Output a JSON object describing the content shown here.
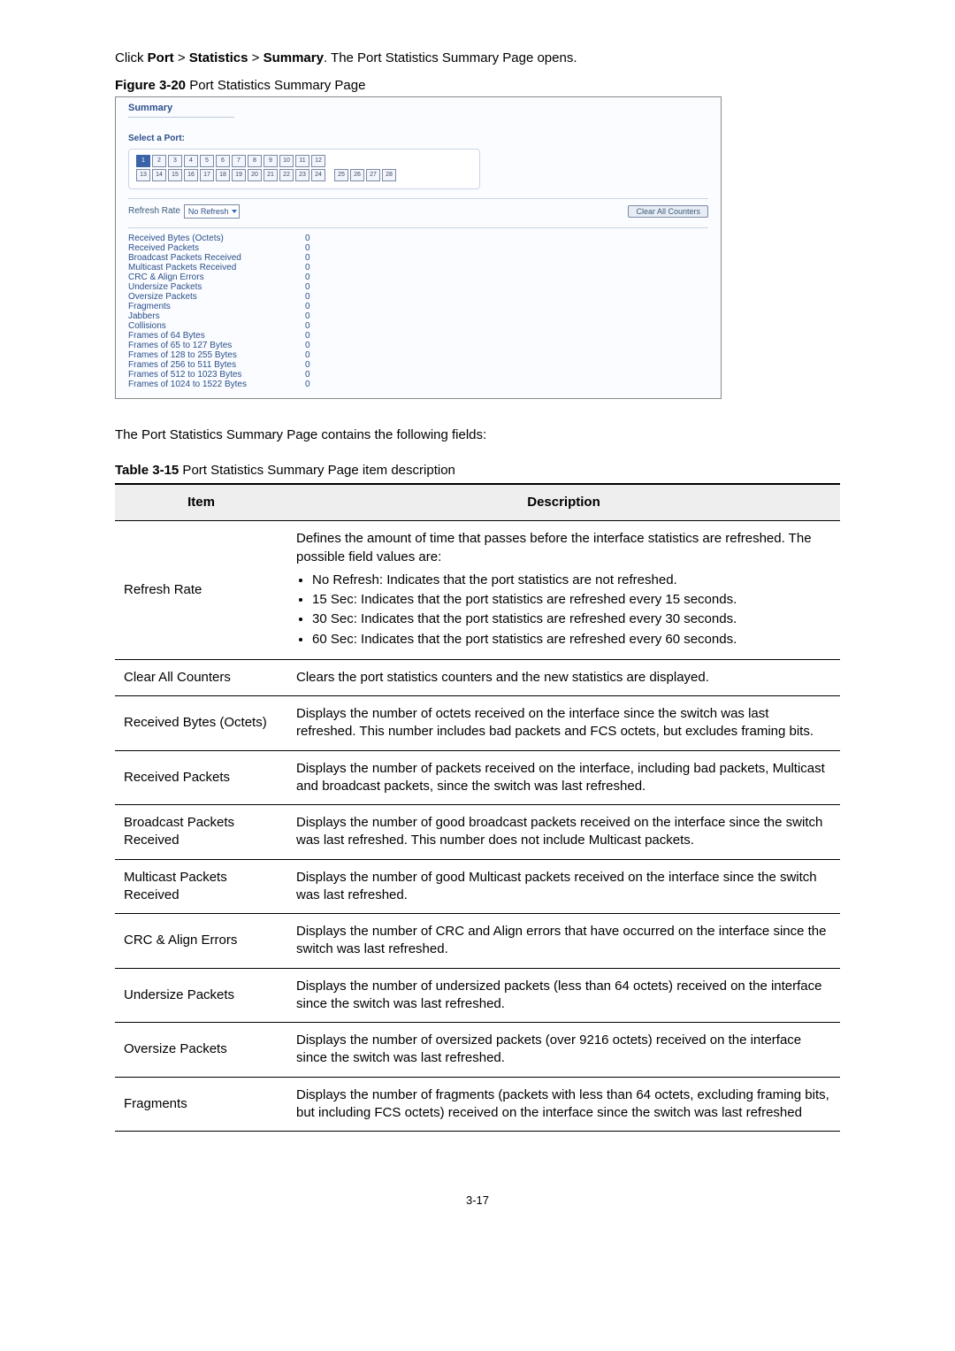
{
  "intro": {
    "prefix": "Click ",
    "port": "Port",
    "sep1": " > ",
    "statistics": "Statistics",
    "sep2": " > ",
    "summary": "Summary",
    "suffix": ". The Port Statistics Summary Page opens."
  },
  "figure_caption_bold": "Figure 3-20",
  "figure_caption_rest": " Port Statistics Summary Page",
  "shot": {
    "title": "Summary",
    "select_label": "Select a Port:",
    "ports_row1": [
      "1",
      "2",
      "3",
      "4",
      "5",
      "6",
      "7",
      "8",
      "9",
      "10",
      "11",
      "12"
    ],
    "ports_row2": [
      "13",
      "14",
      "15",
      "16",
      "17",
      "18",
      "19",
      "20",
      "21",
      "22",
      "23",
      "24",
      "25",
      "26",
      "27",
      "28"
    ],
    "refresh_label": "Refresh Rate",
    "refresh_value": "No Refresh",
    "clear_button": "Clear All Counters",
    "stats": [
      {
        "label": "Received Bytes (Octets)",
        "value": "0"
      },
      {
        "label": "Received Packets",
        "value": "0"
      },
      {
        "label": "Broadcast Packets Received",
        "value": "0"
      },
      {
        "label": "Multicast Packets Received",
        "value": "0"
      },
      {
        "label": "CRC & Align Errors",
        "value": "0"
      },
      {
        "label": "Undersize Packets",
        "value": "0"
      },
      {
        "label": "Oversize Packets",
        "value": "0"
      },
      {
        "label": "Fragments",
        "value": "0"
      },
      {
        "label": "Jabbers",
        "value": "0"
      },
      {
        "label": "Collisions",
        "value": "0"
      },
      {
        "label": "Frames of 64 Bytes",
        "value": "0"
      },
      {
        "label": "Frames of 65 to 127 Bytes",
        "value": "0"
      },
      {
        "label": "Frames of 128 to 255 Bytes",
        "value": "0"
      },
      {
        "label": "Frames of 256 to 511 Bytes",
        "value": "0"
      },
      {
        "label": "Frames of 512 to 1023 Bytes",
        "value": "0"
      },
      {
        "label": "Frames of 1024 to 1522 Bytes",
        "value": "0"
      }
    ]
  },
  "body_text": "The Port Statistics Summary Page contains the following fields:",
  "table_caption_bold": "Table 3-15",
  "table_caption_rest": " Port Statistics Summary Page item description",
  "table": {
    "head_item": "Item",
    "head_desc": "Description",
    "rows": [
      {
        "item": "Refresh Rate",
        "desc_intro": "Defines the amount of time that passes before the interface statistics are refreshed. The possible field values are:",
        "bullets": [
          "No Refresh: Indicates that the port statistics are not refreshed.",
          "15 Sec: Indicates that the port statistics are refreshed every 15 seconds.",
          "30 Sec: Indicates that the port statistics are refreshed every 30 seconds.",
          "60 Sec: Indicates that the port statistics are refreshed every 60 seconds."
        ]
      },
      {
        "item": "Clear All Counters",
        "desc": "Clears the port statistics counters and the new statistics are displayed."
      },
      {
        "item": "Received Bytes (Octets)",
        "desc": "Displays the number of octets received on the interface since the switch was last refreshed. This number includes bad packets and FCS octets, but excludes framing bits."
      },
      {
        "item": "Received Packets",
        "desc": "Displays the number of packets received on the interface, including bad packets, Multicast and broadcast packets, since the switch was last refreshed."
      },
      {
        "item": "Broadcast Packets Received",
        "desc": "Displays the number of good broadcast packets received on the interface since the switch was last refreshed. This number does not include Multicast packets."
      },
      {
        "item": "Multicast Packets Received",
        "desc": "Displays the number of good Multicast packets received on the interface since the switch was last refreshed."
      },
      {
        "item": "CRC & Align Errors",
        "desc": "Displays the number of CRC and Align errors that have occurred on the interface since the switch was last refreshed."
      },
      {
        "item": "Undersize Packets",
        "desc": "Displays the number of undersized packets (less than 64 octets) received on the interface since the switch was last refreshed."
      },
      {
        "item": "Oversize Packets",
        "desc": "Displays the number of oversized packets (over 9216 octets) received on the interface since the switch was last refreshed."
      },
      {
        "item": "Fragments",
        "desc": "Displays the number of fragments (packets with less than 64 octets, excluding framing bits, but including FCS octets) received on the interface since the switch was last refreshed"
      }
    ]
  },
  "footer": "3-17"
}
